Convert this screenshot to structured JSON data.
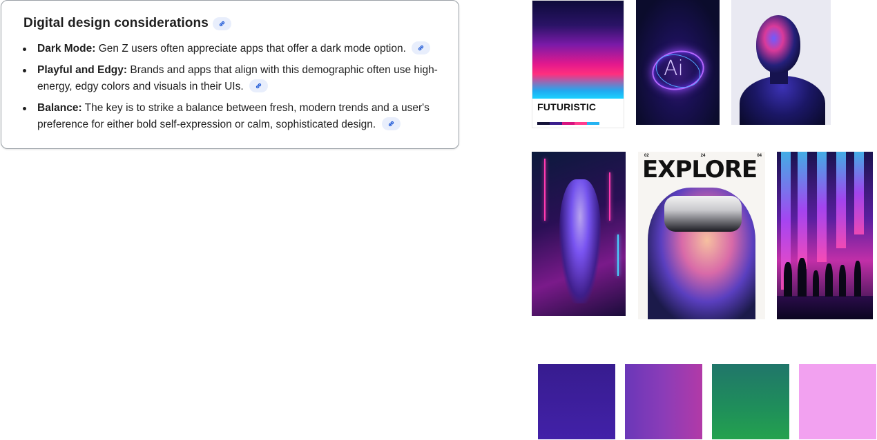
{
  "card": {
    "title": "Digital design considerations",
    "items": [
      {
        "label": "Dark Mode:",
        "text": "Gen Z users often appreciate apps that offer a dark mode option."
      },
      {
        "label": "Playful and Edgy:",
        "text": "Brands and apps that align with this demographic often use high-energy, edgy colors and visuals in their UIs."
      },
      {
        "label": "Balance:",
        "text": "The key is to strike a balance between fresh, modern trends and a user's preference for either bold self-expression or calm, sophisticated design."
      }
    ],
    "link_icon": "link-icon"
  },
  "images": {
    "futuristic": {
      "title": "FUTURISTIC"
    },
    "ai_logo": {
      "text": "Ai"
    },
    "explore": {
      "title": "EXPLORE",
      "nums": [
        "02",
        "24",
        "04"
      ]
    }
  },
  "palette": [
    "#4221a8",
    "#8b3cb8",
    "#1f8f5a",
    "#f2a1f0"
  ]
}
